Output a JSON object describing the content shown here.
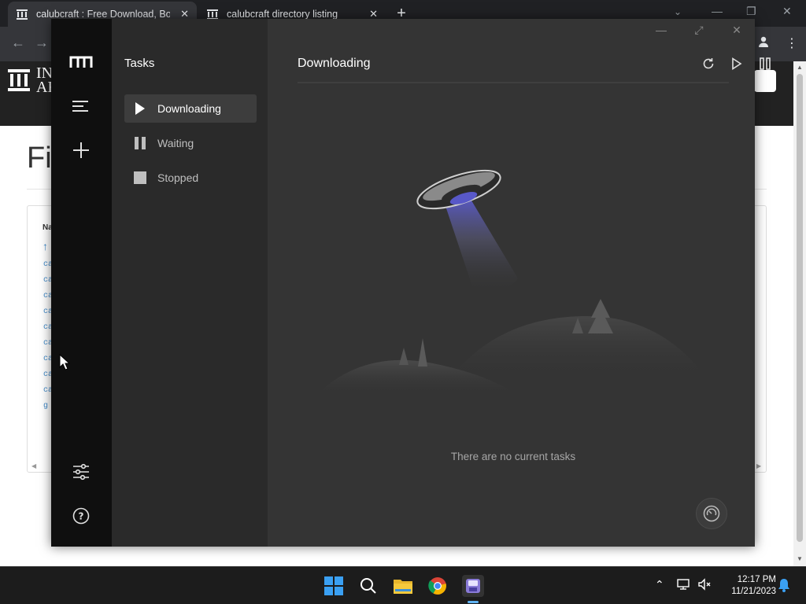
{
  "browser": {
    "tabs": [
      {
        "title": "calubcraft : Free Download, Bor"
      },
      {
        "title": "calubcraft directory listing"
      }
    ]
  },
  "site": {
    "logo_text_line1": "IN",
    "logo_text_line2": "AR",
    "page_title_fragment": "Fi",
    "column_header_fragment": "Na",
    "list_links": [
      "ca",
      "ca",
      "ca",
      "ca",
      "ca",
      "ca",
      "ca",
      "ca",
      "ca",
      "g"
    ]
  },
  "app": {
    "sidebar_title": "Tasks",
    "nav": [
      {
        "label": "Downloading",
        "icon": "play-icon",
        "active": true
      },
      {
        "label": "Waiting",
        "icon": "pause-icon",
        "active": false
      },
      {
        "label": "Stopped",
        "icon": "stop-icon",
        "active": false
      }
    ],
    "main_title": "Downloading",
    "empty_message": "There are no current tasks",
    "accent_color": "#ffffff"
  },
  "taskbar": {
    "time": "12:17 PM",
    "date": "11/21/2023"
  }
}
